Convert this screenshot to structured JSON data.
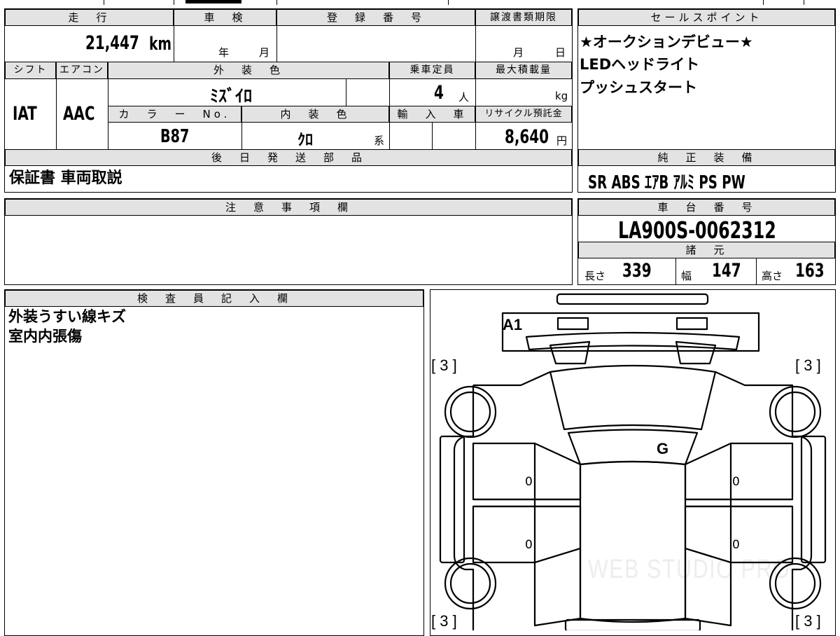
{
  "top": {
    "mileage_label": "走　行",
    "mileage_value": "21,447",
    "mileage_unit": "km",
    "shaken_label": "車　検",
    "shaken_year": "年",
    "shaken_month": "月",
    "reg_label": "登　録　番　号",
    "transfer_label": "譲渡書類期限",
    "transfer_month": "月",
    "transfer_day": "日"
  },
  "row2": {
    "shift_label": "シフト",
    "shift_value": "IAT",
    "ac_label": "エアコン",
    "ac_value": "AAC",
    "color_label": "外　装　色",
    "color_value": "ﾐｽﾞｲﾛ",
    "capacity_label": "乗車定員",
    "capacity_value": "4",
    "capacity_unit": "人",
    "load_label": "最大積載量",
    "load_unit": "kg",
    "colorno_label": "カ　ラ　ー　No.",
    "colorno_value": "B87",
    "interior_label": "内　装　色",
    "interior_value": "ｸﾛ",
    "interior_suffix": "系",
    "import_label": "輸　入　車",
    "recycle_label": "リサイクル預託金",
    "recycle_value": "8,640",
    "recycle_unit": "円"
  },
  "later": {
    "label": "後　日　発　送　部　品",
    "value": "保証書 車両取説"
  },
  "sales": {
    "label": "セールスポイント",
    "lines": [
      "★オークションデビュー★",
      "LEDヘッドライト",
      "プッシュスタート"
    ]
  },
  "equipment": {
    "label": "純　正　装　備",
    "value": "SR ABS ｴｱB ｱﾙﾐ PS PW"
  },
  "notes": {
    "label": "注　意　事　項　欄",
    "value": ""
  },
  "chassis": {
    "label": "車　台　番　号",
    "value": "LA900S-0062312"
  },
  "specs": {
    "label": "諸　元",
    "length_label": "長さ",
    "length_value": "339",
    "width_label": "幅",
    "width_value": "147",
    "height_label": "高さ",
    "height_value": "163"
  },
  "inspector": {
    "label": "検　査　員　記　入　欄",
    "lines": [
      "外装うすい線キズ",
      "室内内張傷"
    ]
  },
  "diagram": {
    "mark_front": "A1",
    "mark_glass": "G",
    "tire_fl": "[ 3 ]",
    "tire_fr": "[ 3 ]",
    "tire_rl": "[ 3 ]",
    "tire_rr": "[ 3 ]",
    "door_fl": "0",
    "door_fr": "0",
    "door_rl": "0",
    "door_rr": "0",
    "watermark": "WEB STUDIO PRO"
  }
}
